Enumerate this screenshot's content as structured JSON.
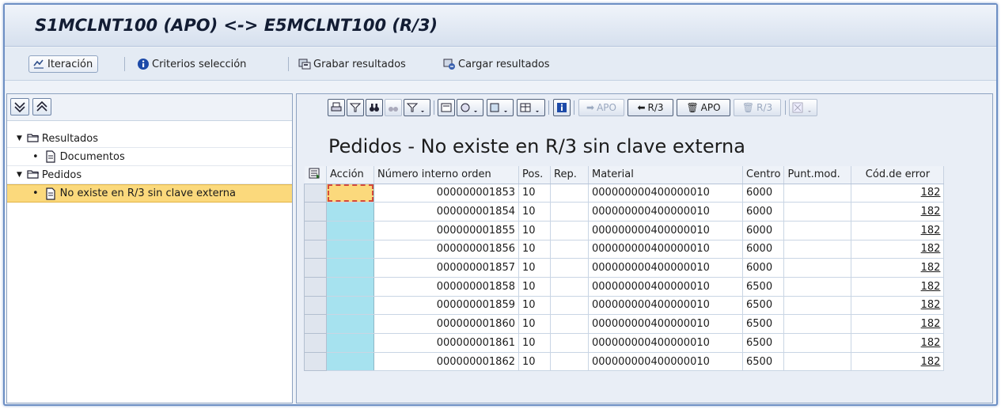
{
  "window": {
    "title": "S1MCLNT100 (APO) <-> E5MCLNT100 (R/3)"
  },
  "app_toolbar": {
    "iteracion": "Iteración",
    "criterios": "Criterios selección",
    "grabar": "Grabar resultados",
    "cargar": "Cargar resultados"
  },
  "tree": {
    "items": [
      {
        "label": "Resultados"
      },
      {
        "label": "Documentos"
      },
      {
        "label": "Pedidos"
      },
      {
        "label": "No existe en R/3 sin clave externa"
      }
    ]
  },
  "grid_toolbar": {
    "to_apo": "APO",
    "to_r3": "R/3",
    "del_apo": "APO",
    "del_r3": "R/3"
  },
  "main": {
    "heading": "Pedidos - No existe en R/3 sin clave externa",
    "columns": [
      "Acción",
      "Número interno orden",
      "Pos.",
      "Rep.",
      "Material",
      "Centro",
      "Punt.mod.",
      "Cód.de error"
    ],
    "rows": [
      {
        "accion": "",
        "orden": "000000001853",
        "pos": "10",
        "rep": "",
        "material": "000000000400000010",
        "centro": "6000",
        "punt": "",
        "error": "182"
      },
      {
        "accion": "",
        "orden": "000000001854",
        "pos": "10",
        "rep": "",
        "material": "000000000400000010",
        "centro": "6000",
        "punt": "",
        "error": "182"
      },
      {
        "accion": "",
        "orden": "000000001855",
        "pos": "10",
        "rep": "",
        "material": "000000000400000010",
        "centro": "6000",
        "punt": "",
        "error": "182"
      },
      {
        "accion": "",
        "orden": "000000001856",
        "pos": "10",
        "rep": "",
        "material": "000000000400000010",
        "centro": "6000",
        "punt": "",
        "error": "182"
      },
      {
        "accion": "",
        "orden": "000000001857",
        "pos": "10",
        "rep": "",
        "material": "000000000400000010",
        "centro": "6000",
        "punt": "",
        "error": "182"
      },
      {
        "accion": "",
        "orden": "000000001858",
        "pos": "10",
        "rep": "",
        "material": "000000000400000010",
        "centro": "6500",
        "punt": "",
        "error": "182"
      },
      {
        "accion": "",
        "orden": "000000001859",
        "pos": "10",
        "rep": "",
        "material": "000000000400000010",
        "centro": "6500",
        "punt": "",
        "error": "182"
      },
      {
        "accion": "",
        "orden": "000000001860",
        "pos": "10",
        "rep": "",
        "material": "000000000400000010",
        "centro": "6500",
        "punt": "",
        "error": "182"
      },
      {
        "accion": "",
        "orden": "000000001861",
        "pos": "10",
        "rep": "",
        "material": "000000000400000010",
        "centro": "6500",
        "punt": "",
        "error": "182"
      },
      {
        "accion": "",
        "orden": "000000001862",
        "pos": "10",
        "rep": "",
        "material": "000000000400000010",
        "centro": "6500",
        "punt": "",
        "error": "182"
      }
    ]
  },
  "colors": {
    "accion_cell": "#a6e2ef",
    "selected": "#fbd97c",
    "frame_border": "#6d8fc4"
  },
  "icons": {
    "iteracion": "iteration-icon",
    "criterios": "info-icon",
    "grabar": "save-results-icon",
    "cargar": "load-results-icon"
  }
}
